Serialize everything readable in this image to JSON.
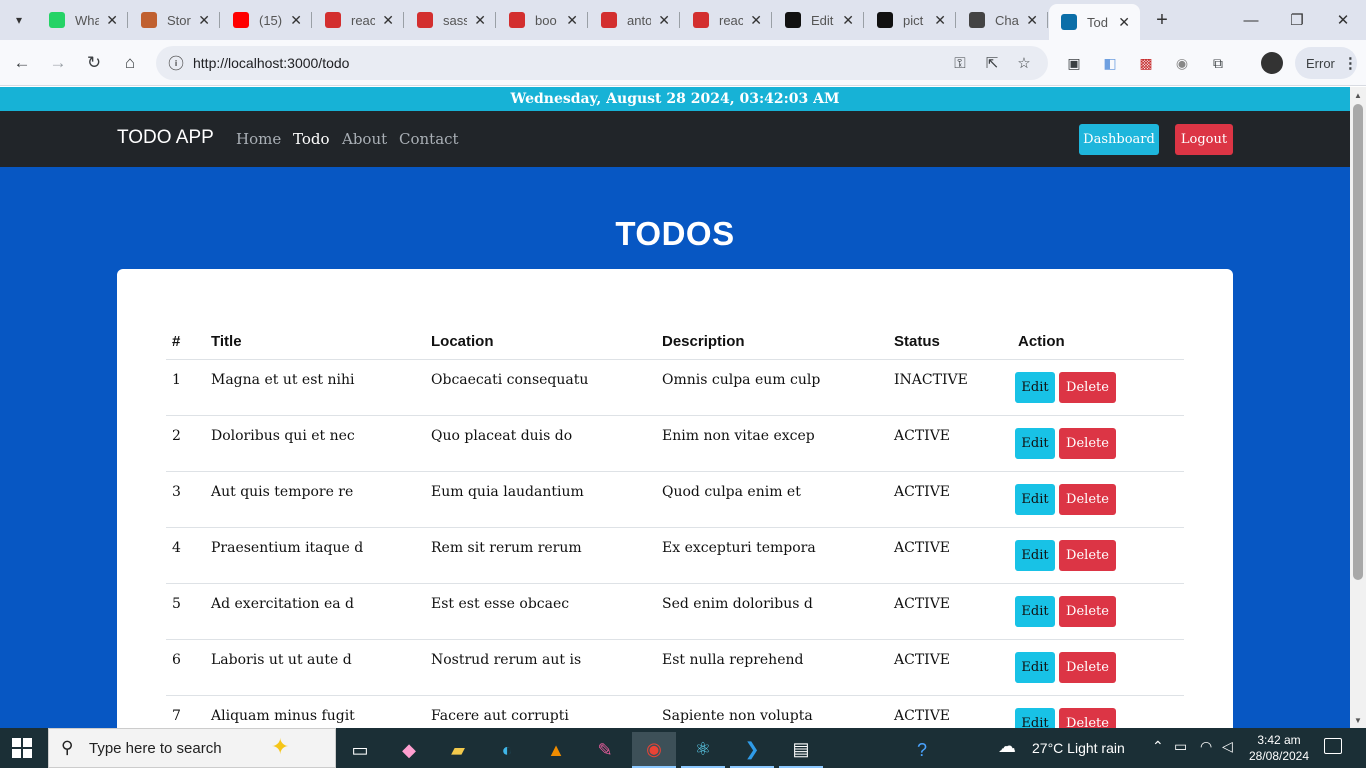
{
  "browser": {
    "tabs": [
      {
        "label": "Wha",
        "icon": "whatsapp-icon",
        "color": "#25d366"
      },
      {
        "label": "Stor",
        "icon": "profile-photo-icon",
        "color": "#c06030"
      },
      {
        "label": "(15)",
        "icon": "youtube-icon",
        "color": "#ff0000"
      },
      {
        "label": "reac",
        "icon": "app-m-icon",
        "color": "#d32f2f"
      },
      {
        "label": "sass",
        "icon": "app-m-icon",
        "color": "#d32f2f"
      },
      {
        "label": "boo",
        "icon": "app-m-icon",
        "color": "#d32f2f"
      },
      {
        "label": "anto",
        "icon": "app-m-icon",
        "color": "#d32f2f"
      },
      {
        "label": "reac",
        "icon": "app-m-icon",
        "color": "#d32f2f"
      },
      {
        "label": "Edit",
        "icon": "github-icon",
        "color": "#111111"
      },
      {
        "label": "pict",
        "icon": "github-icon",
        "color": "#111111"
      },
      {
        "label": "Cha",
        "icon": "chatgpt-icon",
        "color": "#444444"
      },
      {
        "label": "Tod",
        "icon": "react-icon",
        "color": "#0b6ea8"
      }
    ],
    "url": "http://localhost:3000/todo",
    "error_label": "Error"
  },
  "page": {
    "datetime": "Wednesday, August 28 2024, 03:42:03 AM",
    "nav": {
      "brand": "TODO APP",
      "links": [
        "Home",
        "Todo",
        "About",
        "Contact"
      ],
      "dashboard": "Dashboard",
      "logout": "Logout"
    },
    "title": "TODOS",
    "table": {
      "headers": [
        "#",
        "Title",
        "Location",
        "Description",
        "Status",
        "Action"
      ],
      "rows": [
        {
          "num": "1",
          "title": "Magna et ut est nihi",
          "location": "Obcaecati consequatu",
          "description": "Omnis culpa eum culp",
          "status": "INACTIVE"
        },
        {
          "num": "2",
          "title": "Doloribus qui et nec",
          "location": "Quo placeat duis do",
          "description": "Enim non vitae excep",
          "status": "ACTIVE"
        },
        {
          "num": "3",
          "title": "Aut quis tempore re",
          "location": "Eum quia laudantium",
          "description": "Quod culpa enim et",
          "status": "ACTIVE"
        },
        {
          "num": "4",
          "title": "Praesentium itaque d",
          "location": "Rem sit rerum rerum",
          "description": "Ex excepturi tempora",
          "status": "ACTIVE"
        },
        {
          "num": "5",
          "title": "Ad exercitation ea d",
          "location": "Est est esse obcaec",
          "description": "Sed enim doloribus d",
          "status": "ACTIVE"
        },
        {
          "num": "6",
          "title": "Laboris ut ut aute d",
          "location": "Nostrud rerum aut is",
          "description": "Est nulla reprehend",
          "status": "ACTIVE"
        },
        {
          "num": "7",
          "title": "Aliquam minus fugit",
          "location": "Facere aut corrupti",
          "description": "Sapiente non volupta",
          "status": "ACTIVE"
        }
      ],
      "edit_label": "Edit",
      "delete_label": "Delete"
    }
  },
  "taskbar": {
    "search_placeholder": "Type here to search",
    "weather": "27°C  Light rain",
    "time": "3:42 am",
    "date": "28/08/2024"
  },
  "colors": {
    "page_bg": "#0757c3",
    "datebar": "#17b2d6",
    "navbar": "#212529",
    "info": "#18c2e6",
    "danger": "#dc3545"
  }
}
